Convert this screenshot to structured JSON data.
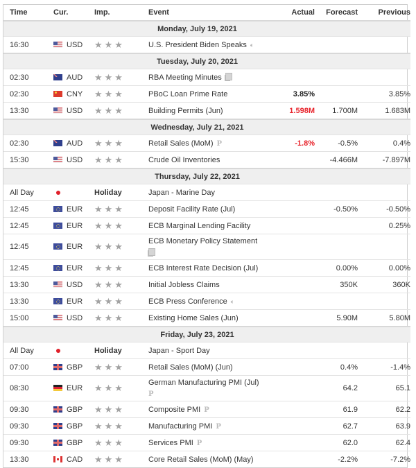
{
  "colors": {
    "negative_actual": "#e8242c",
    "day_header_bg": "#efefef",
    "star": "#a3a3a3",
    "border": "#cfcfcf"
  },
  "headers": {
    "time": "Time",
    "cur": "Cur.",
    "imp": "Imp.",
    "event": "Event",
    "actual": "Actual",
    "forecast": "Forecast",
    "previous": "Previous"
  },
  "importance_glyph": "★★★",
  "days": [
    {
      "label": "Monday, July 19, 2021",
      "rows": [
        {
          "time": "16:30",
          "flag": "usd",
          "cur": "USD",
          "imp": "stars",
          "event": "U.S. President Biden Speaks",
          "icon": "speaker-icon",
          "actual": "",
          "actual_style": "",
          "forecast": "",
          "previous": ""
        }
      ]
    },
    {
      "label": "Tuesday, July 20, 2021",
      "rows": [
        {
          "time": "02:30",
          "flag": "aud",
          "cur": "AUD",
          "imp": "stars",
          "event": "RBA Meeting Minutes",
          "icon": "document-icon",
          "actual": "",
          "actual_style": "",
          "forecast": "",
          "previous": ""
        },
        {
          "time": "02:30",
          "flag": "cny",
          "cur": "CNY",
          "imp": "stars",
          "event": "PBoC Loan Prime Rate",
          "icon": "",
          "actual": "3.85%",
          "actual_style": "bold",
          "forecast": "",
          "previous": "3.85%"
        },
        {
          "time": "13:30",
          "flag": "usd",
          "cur": "USD",
          "imp": "stars",
          "event": "Building Permits (Jun)",
          "icon": "",
          "actual": "1.598M",
          "actual_style": "red",
          "forecast": "1.700M",
          "previous": "1.683M"
        }
      ]
    },
    {
      "label": "Wednesday, July 21, 2021",
      "rows": [
        {
          "time": "02:30",
          "flag": "aud",
          "cur": "AUD",
          "imp": "stars",
          "event": "Retail Sales (MoM)",
          "icon": "preliminary-icon",
          "actual": "-1.8%",
          "actual_style": "red",
          "forecast": "-0.5%",
          "previous": "0.4%"
        },
        {
          "time": "15:30",
          "flag": "usd",
          "cur": "USD",
          "imp": "stars",
          "event": "Crude Oil Inventories",
          "icon": "",
          "actual": "",
          "actual_style": "",
          "forecast": "-4.466M",
          "previous": "-7.897M"
        }
      ]
    },
    {
      "label": "Thursday, July 22, 2021",
      "rows": [
        {
          "time": "All Day",
          "flag": "jp",
          "cur": "",
          "imp": "Holiday",
          "event": "Japan - Marine Day",
          "icon": "",
          "actual": "",
          "actual_style": "",
          "forecast": "",
          "previous": ""
        },
        {
          "time": "12:45",
          "flag": "eur",
          "cur": "EUR",
          "imp": "stars",
          "event": "Deposit Facility Rate (Jul)",
          "icon": "",
          "actual": "",
          "actual_style": "",
          "forecast": "-0.50%",
          "previous": "-0.50%"
        },
        {
          "time": "12:45",
          "flag": "eur",
          "cur": "EUR",
          "imp": "stars",
          "event": "ECB Marginal Lending Facility",
          "icon": "",
          "actual": "",
          "actual_style": "",
          "forecast": "",
          "previous": "0.25%"
        },
        {
          "time": "12:45",
          "flag": "eur",
          "cur": "EUR",
          "imp": "stars",
          "event": "ECB Monetary Policy Statement",
          "icon": "document-icon",
          "wrap": true,
          "actual": "",
          "actual_style": "",
          "forecast": "",
          "previous": ""
        },
        {
          "time": "12:45",
          "flag": "eur",
          "cur": "EUR",
          "imp": "stars",
          "event": "ECB Interest Rate Decision (Jul)",
          "icon": "",
          "actual": "",
          "actual_style": "",
          "forecast": "0.00%",
          "previous": "0.00%"
        },
        {
          "time": "13:30",
          "flag": "usd",
          "cur": "USD",
          "imp": "stars",
          "event": "Initial Jobless Claims",
          "icon": "",
          "actual": "",
          "actual_style": "",
          "forecast": "350K",
          "previous": "360K"
        },
        {
          "time": "13:30",
          "flag": "eur",
          "cur": "EUR",
          "imp": "stars",
          "event": "ECB Press Conference",
          "icon": "speaker-icon",
          "actual": "",
          "actual_style": "",
          "forecast": "",
          "previous": ""
        },
        {
          "time": "15:00",
          "flag": "usd",
          "cur": "USD",
          "imp": "stars",
          "event": "Existing Home Sales (Jun)",
          "icon": "",
          "actual": "",
          "actual_style": "",
          "forecast": "5.90M",
          "previous": "5.80M"
        }
      ]
    },
    {
      "label": "Friday, July 23, 2021",
      "rows": [
        {
          "time": "All Day",
          "flag": "jp",
          "cur": "",
          "imp": "Holiday",
          "event": "Japan - Sport Day",
          "icon": "",
          "actual": "",
          "actual_style": "",
          "forecast": "",
          "previous": ""
        },
        {
          "time": "07:00",
          "flag": "gbp",
          "cur": "GBP",
          "imp": "stars",
          "event": "Retail Sales (MoM) (Jun)",
          "icon": "",
          "actual": "",
          "actual_style": "",
          "forecast": "0.4%",
          "previous": "-1.4%"
        },
        {
          "time": "08:30",
          "flag": "de",
          "cur": "EUR",
          "imp": "stars",
          "event": "German Manufacturing PMI (Jul)",
          "icon": "preliminary-icon",
          "wrap": true,
          "actual": "",
          "actual_style": "",
          "forecast": "64.2",
          "previous": "65.1"
        },
        {
          "time": "09:30",
          "flag": "gbp",
          "cur": "GBP",
          "imp": "stars",
          "event": "Composite PMI",
          "icon": "preliminary-icon",
          "actual": "",
          "actual_style": "",
          "forecast": "61.9",
          "previous": "62.2"
        },
        {
          "time": "09:30",
          "flag": "gbp",
          "cur": "GBP",
          "imp": "stars",
          "event": "Manufacturing PMI",
          "icon": "preliminary-icon",
          "actual": "",
          "actual_style": "",
          "forecast": "62.7",
          "previous": "63.9"
        },
        {
          "time": "09:30",
          "flag": "gbp",
          "cur": "GBP",
          "imp": "stars",
          "event": "Services PMI",
          "icon": "preliminary-icon",
          "actual": "",
          "actual_style": "",
          "forecast": "62.0",
          "previous": "62.4"
        },
        {
          "time": "13:30",
          "flag": "cad",
          "cur": "CAD",
          "imp": "stars",
          "event": "Core Retail Sales (MoM) (May)",
          "icon": "",
          "actual": "",
          "actual_style": "",
          "forecast": "-2.2%",
          "previous": "-7.2%"
        }
      ]
    }
  ]
}
